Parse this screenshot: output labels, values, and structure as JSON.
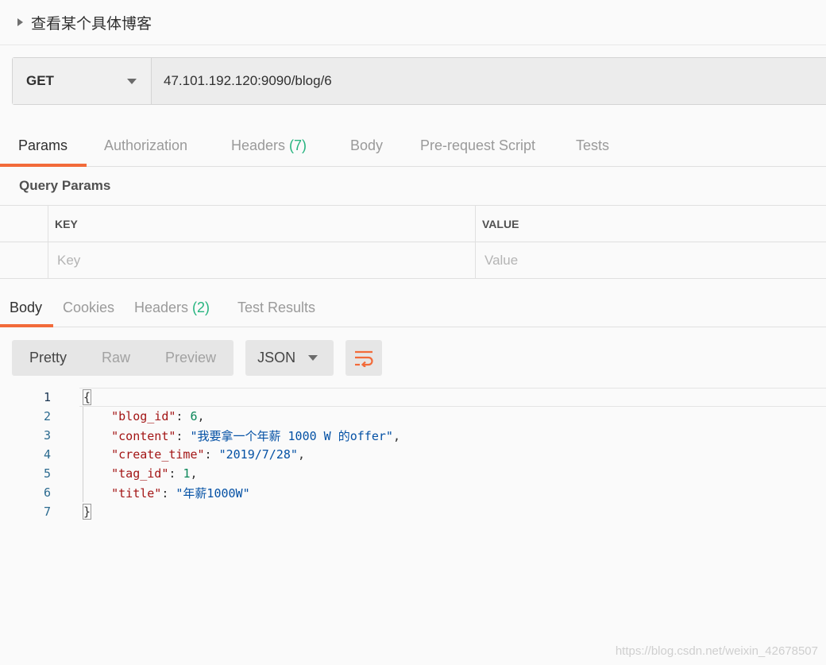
{
  "request_title": "查看某个具体博客",
  "request": {
    "method": "GET",
    "url": "47.101.192.120:9090/blog/6"
  },
  "request_tabs": {
    "params": "Params",
    "authorization": "Authorization",
    "headers": "Headers",
    "headers_count": "(7)",
    "body": "Body",
    "prerequest": "Pre-request Script",
    "tests": "Tests"
  },
  "query_params": {
    "title": "Query Params",
    "key_header": "KEY",
    "value_header": "VALUE",
    "key_placeholder": "Key",
    "value_placeholder": "Value"
  },
  "response_tabs": {
    "body": "Body",
    "cookies": "Cookies",
    "headers": "Headers",
    "headers_count": "(2)",
    "test_results": "Test Results"
  },
  "response_toolbar": {
    "pretty": "Pretty",
    "raw": "Raw",
    "preview": "Preview",
    "format": "JSON"
  },
  "code": {
    "line_numbers": [
      "1",
      "2",
      "3",
      "4",
      "5",
      "6",
      "7"
    ],
    "open_brace": "{",
    "close_brace": "}",
    "fields": [
      {
        "key": "\"blog_id\"",
        "value": "6",
        "value_type": "number",
        "trail": ","
      },
      {
        "key": "\"content\"",
        "value": "\"我要拿一个年薪 1000 W 的offer\"",
        "value_type": "string",
        "trail": ","
      },
      {
        "key": "\"create_time\"",
        "value": "\"2019/7/28\"",
        "value_type": "string",
        "trail": ","
      },
      {
        "key": "\"tag_id\"",
        "value": "1",
        "value_type": "number",
        "trail": ","
      },
      {
        "key": "\"title\"",
        "value": "\"年薪1000W\"",
        "value_type": "string",
        "trail": ""
      }
    ]
  },
  "watermark": "https://blog.csdn.net/weixin_42678507",
  "colors": {
    "accent": "#f26b3a",
    "count_green": "#26b47f",
    "json_key": "#a31515",
    "json_number": "#098658",
    "json_string": "#0451a5"
  },
  "icons": {
    "collapse": "caret-right-icon",
    "dropdown": "chevron-down-icon",
    "wrap": "wrap-lines-icon"
  }
}
